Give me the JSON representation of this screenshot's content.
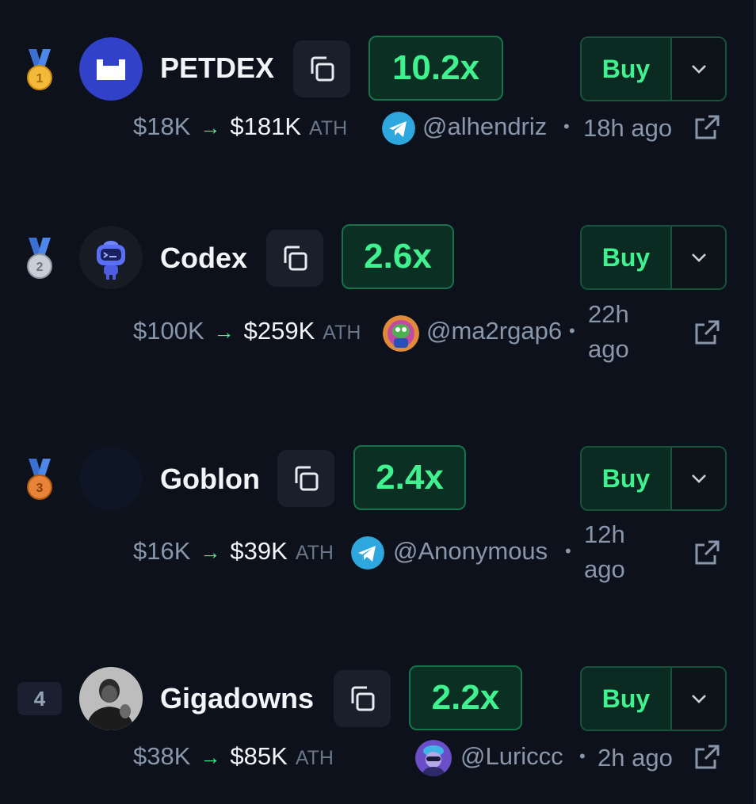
{
  "colors": {
    "background": "#0c111c",
    "accent_green": "#3ff28f",
    "muted_text": "#8a97ab",
    "telegram_blue": "#2ea6de"
  },
  "rows": [
    {
      "rank_icon": "gold-medal-icon",
      "rank_label": "1",
      "name": "PETDEX",
      "multiplier": "10.2x",
      "buy_label": "Buy",
      "mc_from": "$18K",
      "mc_to": "$181K",
      "ath_label": "ATH",
      "caller_icon": "telegram-icon",
      "caller": "@alhendriz",
      "time": "18h ago"
    },
    {
      "rank_icon": "silver-medal-icon",
      "rank_label": "2",
      "name": "Codex",
      "multiplier": "2.6x",
      "buy_label": "Buy",
      "mc_from": "$100K",
      "mc_to": "$259K",
      "ath_label": "ATH",
      "caller_icon": "pepe-avatar-icon",
      "caller": "@ma2rgap6",
      "time_line1": "22h",
      "time_line2": "ago"
    },
    {
      "rank_icon": "bronze-medal-icon",
      "rank_label": "3",
      "name": "Goblon",
      "multiplier": "2.4x",
      "buy_label": "Buy",
      "mc_from": "$16K",
      "mc_to": "$39K",
      "ath_label": "ATH",
      "caller_icon": "telegram-icon",
      "caller": "@Anonymous",
      "time_line1": "12h",
      "time_line2": "ago"
    },
    {
      "rank_label": "4",
      "name": "Gigadowns",
      "multiplier": "2.2x",
      "buy_label": "Buy",
      "mc_from": "$38K",
      "mc_to": "$85K",
      "ath_label": "ATH",
      "caller_icon": "user-avatar-icon",
      "caller": "@Luriccc",
      "time": "2h ago"
    }
  ]
}
